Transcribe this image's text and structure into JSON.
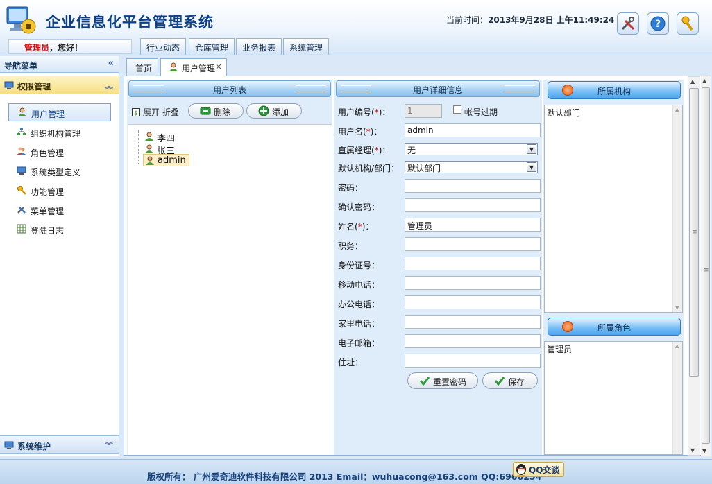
{
  "header": {
    "title": "企业信息化平台管理系统",
    "time_label": "当前时间：",
    "time_value": "2013年9月28日 上午11:49:24",
    "icons": [
      "tools-icon",
      "help-icon",
      "key-icon"
    ]
  },
  "welcome": {
    "user": "管理员",
    "suffix": "，您好！"
  },
  "top_tabs": [
    "行业动态",
    "仓库管理",
    "业务报表",
    "系统管理"
  ],
  "nav": {
    "title": "导航菜单",
    "group1": "权限管理",
    "items": [
      "用户管理",
      "组织机构管理",
      "角色管理",
      "系统类型定义",
      "功能管理",
      "菜单管理",
      "登陆日志"
    ],
    "group2": "系统维护"
  },
  "content_tabs": {
    "home": "首页",
    "current": "用户管理",
    "close": "×"
  },
  "user_list": {
    "title": "用户列表",
    "expand": "展开",
    "collapse": "折叠",
    "delete_label": "删除",
    "add_label": "添加",
    "users": [
      "李四",
      "张三",
      "admin"
    ]
  },
  "detail": {
    "title": "用户详细信息",
    "fields": {
      "user_id": {
        "label": "用户编号(",
        "req": "*",
        "end": ")：",
        "value": "1"
      },
      "account_expired": "帐号过期",
      "username": {
        "label": "用户名(",
        "req": "*",
        "end": ")：",
        "value": "admin"
      },
      "manager": {
        "label": "直属经理(",
        "req": "*",
        "end": ")：",
        "value": "无"
      },
      "org": {
        "label": "默认机构/部门：",
        "value": "默认部门"
      },
      "password": {
        "label": "密码：",
        "value": ""
      },
      "confirm": {
        "label": "确认密码：",
        "value": ""
      },
      "name": {
        "label": "姓名(",
        "req": "*",
        "end": ")：",
        "value": "管理员"
      },
      "position": {
        "label": "职务：",
        "value": ""
      },
      "id_card": {
        "label": "身份证号：",
        "value": ""
      },
      "mobile": {
        "label": "移动电话：",
        "value": ""
      },
      "office_phone": {
        "label": "办公电话：",
        "value": ""
      },
      "home_phone": {
        "label": "家里电话：",
        "value": ""
      },
      "email": {
        "label": "电子邮箱：",
        "value": ""
      },
      "address": {
        "label": "住址：",
        "value": ""
      }
    },
    "reset_label": "重置密码",
    "save_label": "保存"
  },
  "org_panel": {
    "title": "所属机构",
    "value": "默认部门"
  },
  "role_panel": {
    "title": "所属角色",
    "value": "管理员"
  },
  "footer": {
    "text": "版权所有： 广州爱奇迪软件科技有限公司 2013 Email：wuhuacong@163.com QQ:6966254",
    "qq_label": "QQ交谈"
  }
}
